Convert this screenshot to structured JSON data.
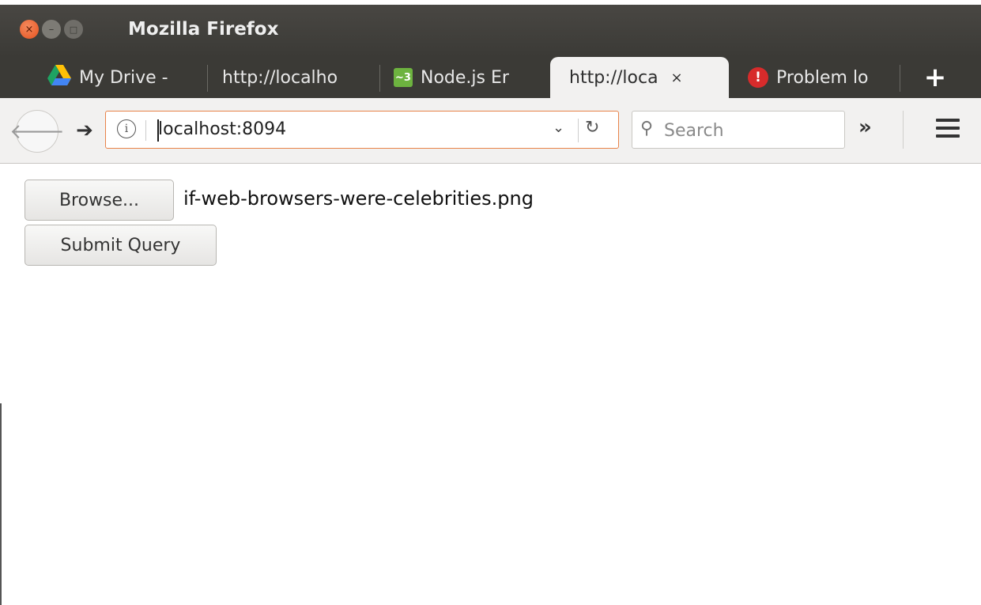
{
  "window": {
    "title": "Mozilla Firefox",
    "buttons": {
      "close": "×",
      "minimize": "–",
      "maximize": "□"
    }
  },
  "tabs": [
    {
      "label": "My Drive -",
      "icon": "google-drive-icon",
      "active": false
    },
    {
      "label": "http://localho",
      "icon": "",
      "active": false
    },
    {
      "label": "Node.js Er",
      "icon": "node-w3-icon",
      "active": false
    },
    {
      "label": "http://loca",
      "icon": "",
      "active": true
    },
    {
      "label": "Problem lo",
      "icon": "warning-icon",
      "active": false
    }
  ],
  "favicon_glyphs": {
    "node": "~3",
    "warning": "!"
  },
  "tab_close_glyph": "×",
  "new_tab_glyph": "+",
  "navbar": {
    "url": "localhost:8094",
    "search_placeholder": "Search",
    "back_glyph": "🡐",
    "forward_glyph": "➔",
    "info_glyph": "i",
    "dropdown_glyph": "⌄",
    "reload_glyph": "↻",
    "search_glyph": "⚲",
    "overflow_glyph": "»"
  },
  "page": {
    "browse_label": "Browse...",
    "filename": "if-web-browsers-were-celebrities.png",
    "submit_label": "Submit Query"
  },
  "colors": {
    "titlebar": "#3b3a36",
    "urlbar_focus": "#e8834a",
    "close_button": "#e5521f",
    "drive_green": "#1ea362",
    "drive_yellow": "#ffc107",
    "drive_blue": "#4285f4",
    "node_green": "#6db33f",
    "warning_red": "#d72b2b"
  }
}
